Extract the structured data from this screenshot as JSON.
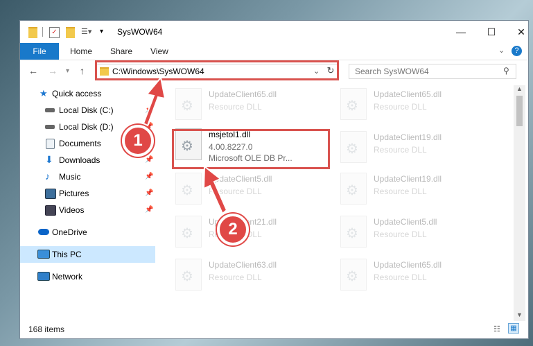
{
  "window": {
    "title": "SysWOW64"
  },
  "ribbon": {
    "file": "File",
    "tabs": [
      "Home",
      "Share",
      "View"
    ]
  },
  "address": {
    "path": "C:\\Windows\\SysWOW64",
    "search_placeholder": "Search SysWOW64"
  },
  "sidebar": {
    "items": [
      {
        "label": "Quick access",
        "icon": "star-icon",
        "pinned": false
      },
      {
        "label": "Local Disk (C:)",
        "icon": "drive-icon",
        "pinned": true
      },
      {
        "label": "Local Disk (D:)",
        "icon": "drive-icon",
        "pinned": true
      },
      {
        "label": "Documents",
        "icon": "documents-icon",
        "pinned": true
      },
      {
        "label": "Downloads",
        "icon": "download-icon",
        "pinned": true
      },
      {
        "label": "Music",
        "icon": "music-icon",
        "pinned": true
      },
      {
        "label": "Pictures",
        "icon": "pictures-icon",
        "pinned": true
      },
      {
        "label": "Videos",
        "icon": "videos-icon",
        "pinned": true
      },
      {
        "label": "OneDrive",
        "icon": "cloud-icon",
        "pinned": false
      },
      {
        "label": "This PC",
        "icon": "computer-icon",
        "pinned": false,
        "selected": true
      },
      {
        "label": "Network",
        "icon": "network-icon",
        "pinned": false
      }
    ]
  },
  "files": {
    "left": [
      {
        "name": "UpdateClient65.dll",
        "desc": "Resource DLL"
      },
      {
        "name": "msjetol1.dll",
        "desc": "4.00.8227.0",
        "desc2": "Microsoft OLE DB Pr...",
        "highlight": true
      },
      {
        "name": "UpdateClient5.dll",
        "desc": "Resource DLL"
      },
      {
        "name": "UpdateClient21.dll",
        "desc": "Resource DLL"
      },
      {
        "name": "UpdateClient63.dll",
        "desc": "Resource DLL"
      }
    ],
    "right": [
      {
        "name": "UpdateClient65.dll",
        "desc": "Resource DLL"
      },
      {
        "name": "UpdateClient19.dll",
        "desc": "Resource DLL"
      },
      {
        "name": "UpdateClient19.dll",
        "desc": "Resource DLL"
      },
      {
        "name": "UpdateClient5.dll",
        "desc": "Resource DLL"
      },
      {
        "name": "UpdateClient65.dll",
        "desc": "Resource DLL"
      }
    ]
  },
  "status": {
    "count": "168 items"
  },
  "annotations": {
    "badge1": "1",
    "badge2": "2"
  },
  "colors": {
    "accent": "#1979ca",
    "annotation": "#d9534f"
  }
}
